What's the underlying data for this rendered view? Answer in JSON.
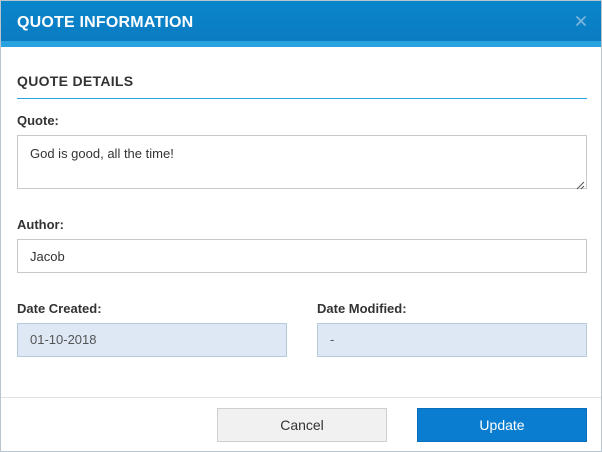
{
  "modal": {
    "title": "QUOTE INFORMATION",
    "close_icon": "close-icon"
  },
  "section": {
    "title": "QUOTE DETAILS"
  },
  "fields": {
    "quote": {
      "label": "Quote:",
      "value": "God is good, all the time!"
    },
    "author": {
      "label": "Author:",
      "value": "Jacob"
    },
    "date_created": {
      "label": "Date Created:",
      "value": "01-10-2018"
    },
    "date_modified": {
      "label": "Date Modified:",
      "value": "-"
    }
  },
  "buttons": {
    "cancel": "Cancel",
    "update": "Update"
  },
  "colors": {
    "header": "#0b7ac0",
    "accent": "#29a3e0",
    "readonly_bg": "#dde8f4",
    "primary_button": "#0b7dd1"
  }
}
